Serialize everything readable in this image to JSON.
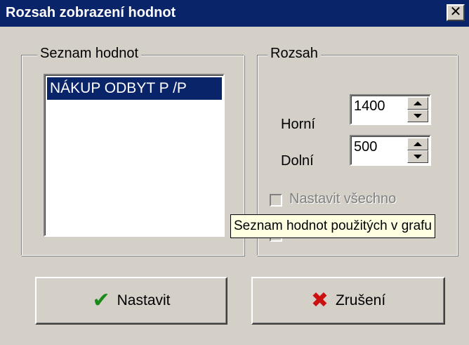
{
  "window": {
    "title": "Rozsah zobrazení hodnot",
    "close_glyph": "✕"
  },
  "values_group": {
    "label": "Seznam hodnot",
    "items": [
      {
        "label": "NÁKUP ODBYT P /P",
        "selected": true
      }
    ]
  },
  "range_group": {
    "label": "Rozsah",
    "upper": {
      "label": "Horní",
      "value": "1400"
    },
    "lower": {
      "label": "Dolní",
      "value": "500"
    },
    "set_all": {
      "label": "Nastavit všechno",
      "checked": false,
      "enabled": false
    },
    "second_option": {
      "label": "",
      "checked": false,
      "enabled": false
    }
  },
  "tooltip": {
    "text": "Seznam hodnot použitých v grafu"
  },
  "buttons": {
    "ok": {
      "label": "Nastavit",
      "icon": "checkmark-icon",
      "color": "#1a8a1a"
    },
    "cancel": {
      "label": "Zrušení",
      "icon": "x-icon",
      "color": "#cc1111"
    }
  },
  "colors": {
    "face": "#d4d0c8",
    "titlebar": "#0a246a",
    "selection": "#0a246a",
    "tooltip_bg": "#ffffe1"
  }
}
